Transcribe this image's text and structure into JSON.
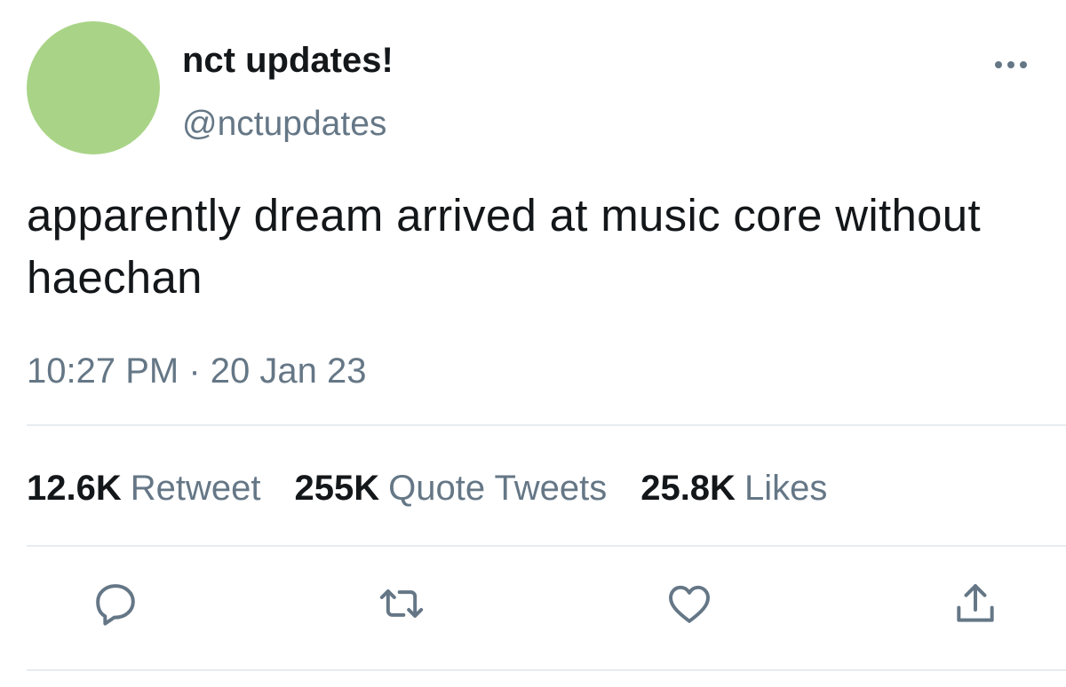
{
  "tweet": {
    "author": {
      "display_name": "nct updates!",
      "handle": "@nctupdates",
      "avatar_color": "#a9d487"
    },
    "text": "apparently dream arrived at music core without haechan",
    "timestamp": "10:27 PM · 20 Jan 23",
    "stats": [
      {
        "count": "12.6K",
        "label": "Retweet"
      },
      {
        "count": "255K",
        "label": "Quote Tweets"
      },
      {
        "count": "25.8K",
        "label": "Likes"
      }
    ],
    "actions": [
      {
        "icon": "reply-icon"
      },
      {
        "icon": "retweet-icon"
      },
      {
        "icon": "heart-icon"
      },
      {
        "icon": "share-icon"
      }
    ]
  },
  "colors": {
    "text_primary": "#14171a",
    "text_secondary": "#657786",
    "divider": "#e6ecf0"
  }
}
